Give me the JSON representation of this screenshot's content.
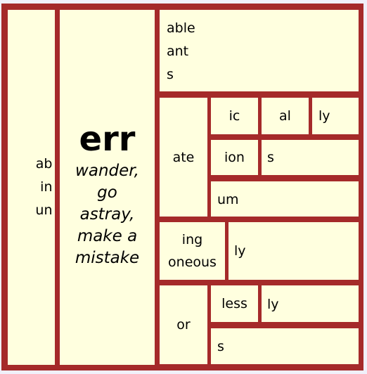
{
  "colors": {
    "border": "#a52a2a",
    "cell": "#ffffdf",
    "background": "#f0f0fa"
  },
  "prefixes": [
    "ab",
    "in",
    "un"
  ],
  "root": {
    "word": "err",
    "meaning": [
      "wander,",
      "go",
      "astray,",
      "make a",
      "mistake"
    ]
  },
  "suffixes": {
    "group1": [
      "able",
      "ant",
      "s"
    ],
    "ate": {
      "label": "ate",
      "row1": [
        "ic",
        "al",
        "ly"
      ],
      "row2": [
        "ion",
        "s"
      ],
      "row3": [
        "um"
      ]
    },
    "ing": {
      "label": [
        "ing",
        "oneous"
      ],
      "next": "ly"
    },
    "or": {
      "label": "or",
      "row1": [
        "less",
        "ly"
      ],
      "row2": [
        "s"
      ]
    }
  }
}
